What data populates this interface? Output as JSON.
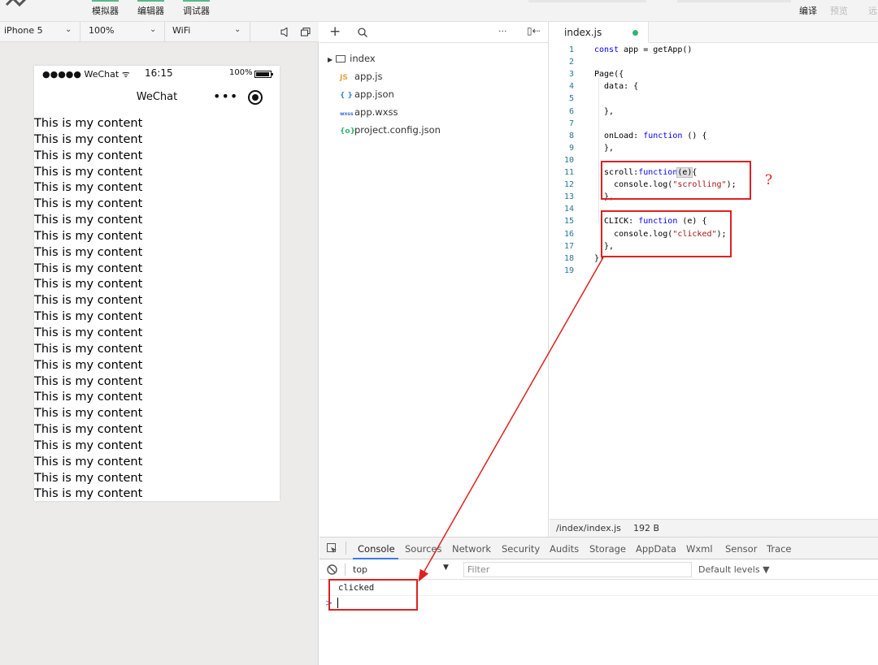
{
  "toolbar": {
    "simulator": "模拟器",
    "editor": "编辑器",
    "debugger": "调试器",
    "compile": "编译",
    "preview": "预览",
    "remote": "远"
  },
  "simulator_bar": {
    "device": "iPhone 5",
    "zoom": "100%",
    "network": "WiFi"
  },
  "phone": {
    "carrier": "●●●●● WeChat ᯤ",
    "time": "16:15",
    "battery": "100%",
    "nav_title": "WeChat",
    "menu": "•••",
    "content_line": "This is my content",
    "content_count": 24
  },
  "file_tree": {
    "ellipsis": "···",
    "items": [
      {
        "icon": "▸ 🗀",
        "name": "index"
      },
      {
        "icon": "JS",
        "name": "app.js"
      },
      {
        "icon": "{ }",
        "name": "app.json"
      },
      {
        "icon": "wxss",
        "name": "app.wxss"
      },
      {
        "icon": "{o}",
        "name": "project.config.json"
      }
    ]
  },
  "editor": {
    "tab": "index.js",
    "file_path": "/index/index.js",
    "file_size": "192 B",
    "lines": [
      "const app = getApp()",
      "",
      "Page({",
      "  data: {",
      "",
      "  },",
      "",
      "  onLoad: function () {",
      "  },",
      "",
      "  scroll:function(e){",
      "    console.log(\"scrolling\");",
      "  },",
      "",
      "  CLICK: function (e) {",
      "    console.log(\"clicked\");",
      "  },",
      "})",
      ""
    ]
  },
  "devtools": {
    "tabs": [
      "Console",
      "Sources",
      "Network",
      "Security",
      "Audits",
      "Storage",
      "AppData",
      "Wxml",
      "Sensor",
      "Trace"
    ],
    "context": "top",
    "filter_placeholder": "Filter",
    "levels": "Default levels ▼",
    "log": "clicked",
    "prompt": ">"
  },
  "annotation": {
    "question_mark": "?",
    "color": "#e02020"
  }
}
